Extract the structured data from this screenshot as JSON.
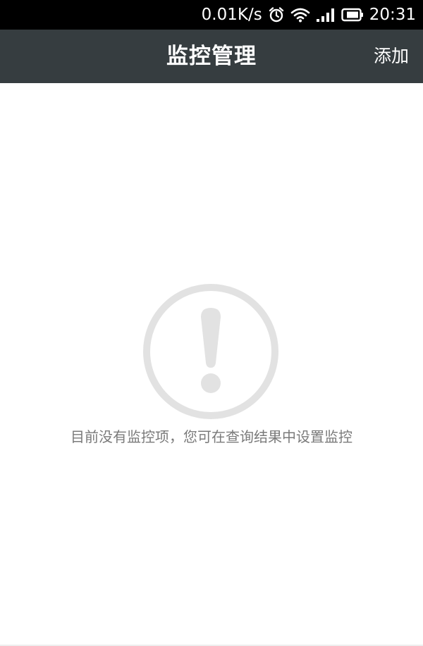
{
  "status_bar": {
    "network_speed": "0.01K/s",
    "time": "20:31",
    "icons": [
      "alarm-icon",
      "wifi-icon",
      "signal-icon",
      "battery-icon"
    ]
  },
  "header": {
    "title": "监控管理",
    "add_label": "添加"
  },
  "empty_state": {
    "icon": "exclamation-circle-icon",
    "message": "目前没有监控项，您可在查询结果中设置监控"
  },
  "colors": {
    "status_bar_bg": "#000000",
    "header_bg": "#363d40",
    "icon_gray": "#e2e2e2",
    "message_text": "#7a7a7a"
  }
}
